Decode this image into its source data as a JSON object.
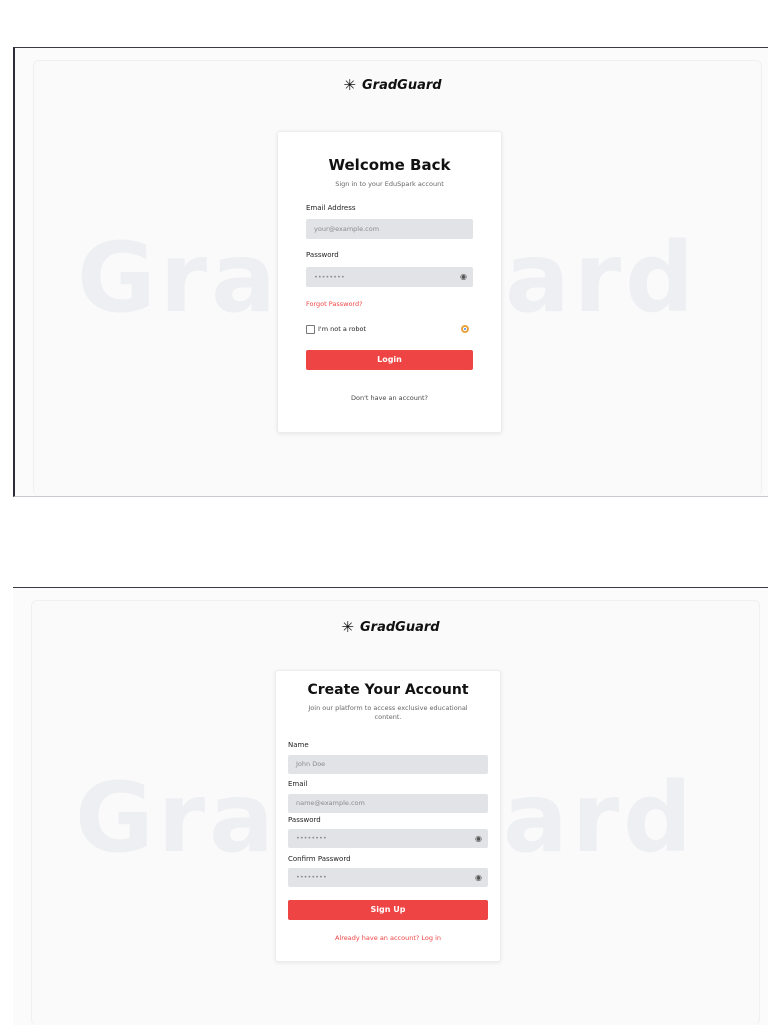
{
  "brand": {
    "name": "GradGuard",
    "icon": "asterisk-logo-icon"
  },
  "watermark": {
    "left": "Gra",
    "right": "ard"
  },
  "login": {
    "title": "Welcome Back",
    "subtitle": "Sign in to your EduSpark account",
    "email_label": "Email Address",
    "email_placeholder": "your@example.com",
    "password_label": "Password",
    "password_value": "••••••••",
    "forgot_password": "Forgot Password?",
    "captcha_label": "I'm not a robot",
    "login_button": "Login",
    "signup_prompt": "Don't have an account?"
  },
  "signup": {
    "title": "Create Your Account",
    "subtitle": "Join our platform to access exclusive educational content.",
    "name_label": "Name",
    "name_placeholder": "John Doe",
    "email_label": "Email",
    "email_placeholder": "name@example.com",
    "password_label": "Password",
    "password_value": "••••••••",
    "confirm_label": "Confirm Password",
    "confirm_value": "••••••••",
    "signup_button": "Sign Up",
    "login_prompt": "Already have an account? Log in"
  },
  "colors": {
    "accent": "#ef4444",
    "input_bg": "#e2e3e6"
  }
}
